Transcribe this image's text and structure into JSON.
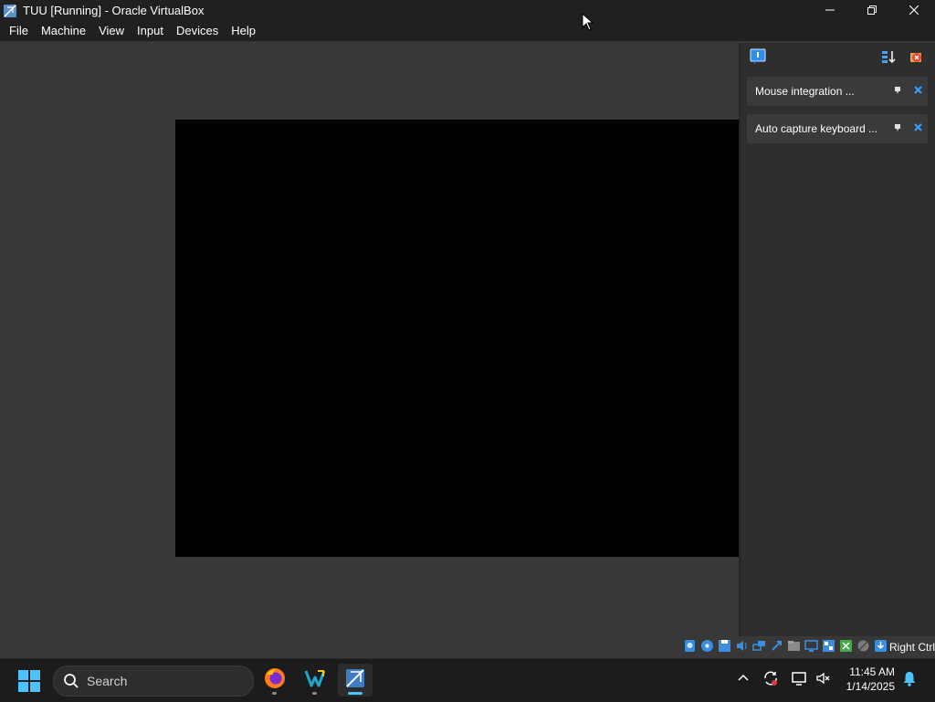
{
  "window": {
    "title": "TUU [Running] - Oracle VirtualBox",
    "app_icon": "virtualbox-logo",
    "controls": [
      "minimize-icon",
      "restore-icon",
      "close-icon"
    ]
  },
  "menu": {
    "items": [
      "File",
      "Machine",
      "View",
      "Input",
      "Devices",
      "Help"
    ]
  },
  "notification_center": {
    "toolbar_icons": [
      "notification-center-icon",
      "sort-icon",
      "clear-all-icon"
    ],
    "items": [
      {
        "text": "Mouse integration ..."
      },
      {
        "text": "Auto capture keyboard ..."
      }
    ]
  },
  "statusbar": {
    "icons": [
      "hard-disk-icon",
      "optical-drive-icon",
      "floppy-icon",
      "audio-icon",
      "network-icon",
      "usb-icon",
      "shared-folders-icon",
      "display-icon",
      "video-capture-icon",
      "cpu-icon",
      "mouse-integration-icon",
      "keyboard-capture-icon"
    ],
    "host_key": "Right Ctrl"
  },
  "taskbar": {
    "search_placeholder": "Search",
    "apps": [
      "firefox-icon",
      "visual-studio-code-icon",
      "virtualbox-icon"
    ],
    "tray_icons": [
      "chevron-up-icon",
      "sync-icon",
      "network-display-icon",
      "volume-muted-icon",
      "notification-bell-icon"
    ],
    "time": "11:45 AM",
    "date": "1/14/2025"
  },
  "colors": {
    "accent": "#4cc2ff",
    "vm_background": "#383838",
    "titlebar": "#202020",
    "guest_screen": "#000000"
  }
}
